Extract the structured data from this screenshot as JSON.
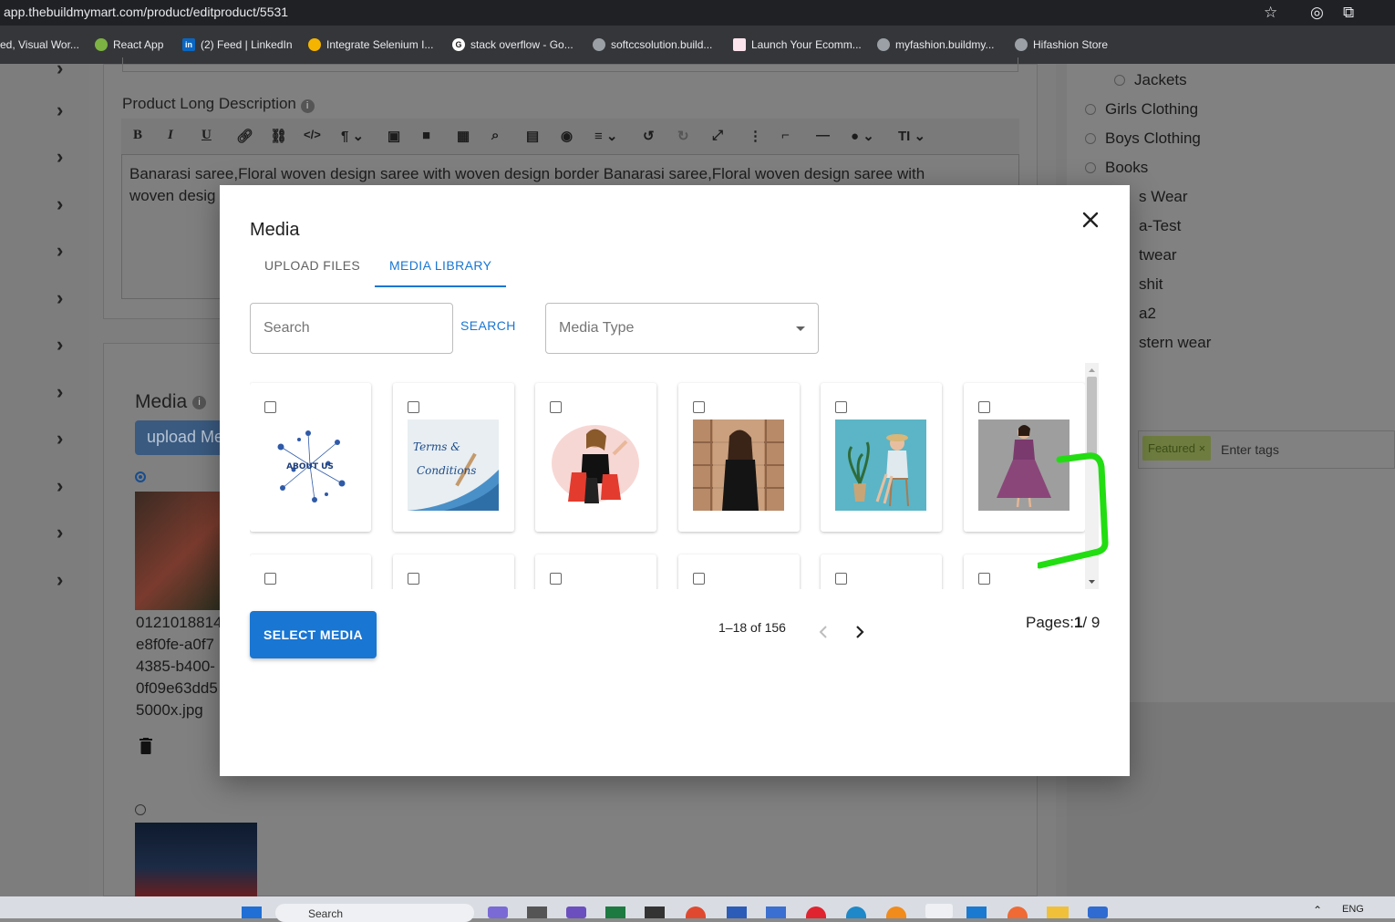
{
  "browser": {
    "url": "app.thebuildmymart.com/product/editproduct/5531",
    "bookmarks": [
      "ed, Visual Wor...",
      "React App",
      "(2) Feed | LinkedIn",
      "Integrate Selenium I...",
      "stack overflow - Go...",
      "softccsolution.build...",
      "Launch Your Ecomm...",
      "myfashion.buildmy...",
      "Hifashion Store"
    ]
  },
  "background_page": {
    "long_description_label": "Product Long Description",
    "description_text_line1": "Banarasi saree,Floral woven design saree with woven design border Banarasi saree,Floral woven design saree with",
    "description_text_line2": "woven desig",
    "media_label": "Media",
    "upload_button": "upload Me",
    "file_name_lines": [
      "0121018814_",
      "e8f0fe-a0f7",
      "4385-b400-",
      "0f09e63dd5",
      "5000x.jpg"
    ],
    "categories": [
      "Jackets",
      "Girls Clothing",
      "Boys Clothing",
      "Books",
      "s Wear",
      "a-Test",
      "twear",
      "shit",
      "a2",
      "stern wear"
    ],
    "tag_chip": "Featured ×",
    "tags_placeholder": "Enter tags"
  },
  "modal": {
    "title": "Media",
    "tabs": [
      {
        "label": "UPLOAD FILES",
        "active": false
      },
      {
        "label": "MEDIA LIBRARY",
        "active": true
      }
    ],
    "search_placeholder": "Search",
    "search_button": "SEARCH",
    "media_type_placeholder": "Media Type",
    "tiles": [
      {
        "name": "about-us-image",
        "text": "ABOUT US"
      },
      {
        "name": "terms-conditions-image",
        "text": "Terms & Conditions"
      },
      {
        "name": "shopping-woman-image",
        "text": ""
      },
      {
        "name": "woman-black-dress-image",
        "text": ""
      },
      {
        "name": "woman-sitting-image",
        "text": ""
      },
      {
        "name": "purple-dress-image",
        "text": ""
      }
    ],
    "select_button": "SELECT MEDIA",
    "range_text": "1–18 of 156",
    "pages_label": "Pages:",
    "current_page": "1",
    "total_pages": "/ 9"
  },
  "taskbar": {
    "search_label": "Search",
    "lang": "ENG"
  },
  "colors": {
    "primary": "#1976d2",
    "annotation": "#22dd11"
  }
}
